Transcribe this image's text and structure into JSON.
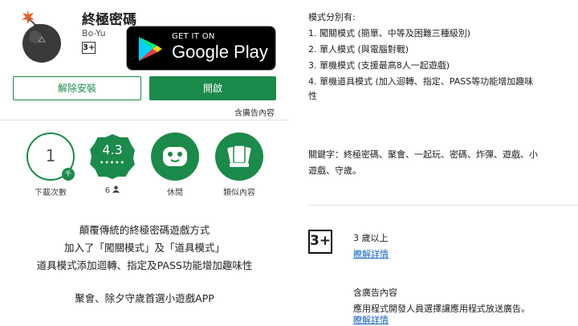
{
  "app": {
    "title": "終極密碼",
    "developer": "Bo-Yu",
    "content_rating": "3+",
    "badge": {
      "line1": "GET IT ON",
      "line2": "Google Play"
    }
  },
  "actions": {
    "uninstall": "解除安裝",
    "open": "開啟",
    "ads_note": "含廣告內容"
  },
  "stats": [
    {
      "value": "1",
      "badge": "千",
      "label": "下載次數"
    },
    {
      "value": "4.3",
      "stars": "★★★★★",
      "label": "6"
    },
    {
      "icon": "gamepad-icon",
      "label": "休閒"
    },
    {
      "icon": "cards-icon",
      "label": "類似內容"
    }
  ],
  "description": [
    "顛覆傳統的終極密碼遊戲方式",
    "加入了「闖關模式」及「道具模式」",
    "道具模式添加迴轉、指定及PASS功能增加趣味性",
    "",
    "聚會、除夕守歲首選小遊戲APP"
  ],
  "modes": {
    "heading": "模式分別有:",
    "items": [
      "1. 闖關模式 (簡單、中等及困難三種級別)",
      "2. 單人模式 (與電腦對戰)",
      "3. 單機模式 (支援最高8人一起遊戲)",
      "4. 單機道具模式 (加入迴轉、指定、PASS等功能增加趣味",
      "性"
    ]
  },
  "keywords": {
    "line1": "關鍵字：終極密碼、聚會、一起玩、密碼、炸彈、遊戲、小",
    "line2": "遊戲、守歲。"
  },
  "rating_info": {
    "icon_text": "3+",
    "age": "3 歲以上",
    "learn_more": "瞭解詳情"
  },
  "ads_info": {
    "title": "含廣告內容",
    "text": "應用程式開發人員選擇讓應用程式放送廣告。",
    "learn_more": "瞭解詳情"
  },
  "colors": {
    "accent": "#1b8a4a",
    "link": "#1565c0"
  }
}
